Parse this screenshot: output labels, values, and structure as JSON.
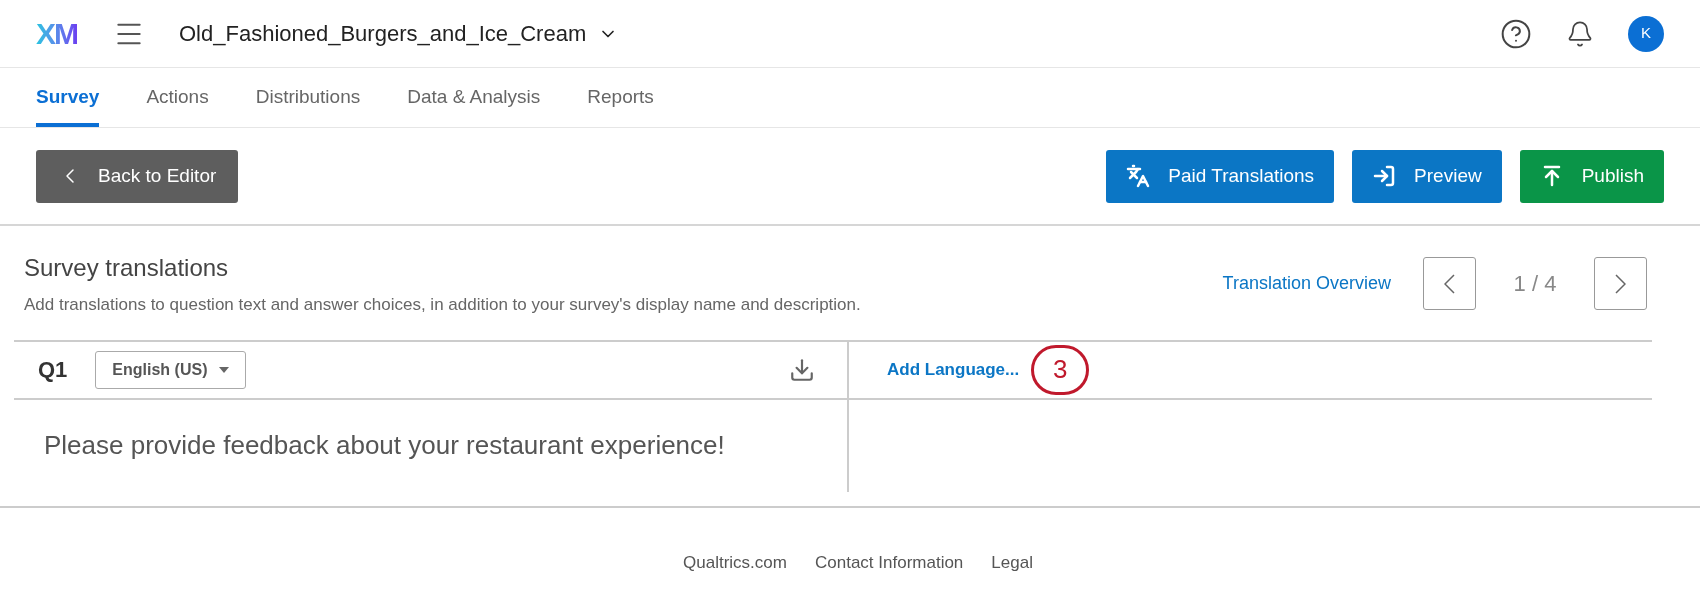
{
  "header": {
    "logo": "XM",
    "project_title": "Old_Fashioned_Burgers_and_Ice_Cream",
    "avatar_initial": "K"
  },
  "tabs": [
    {
      "label": "Survey",
      "selected": true
    },
    {
      "label": "Actions",
      "selected": false
    },
    {
      "label": "Distributions",
      "selected": false
    },
    {
      "label": "Data & Analysis",
      "selected": false
    },
    {
      "label": "Reports",
      "selected": false
    }
  ],
  "toolbar": {
    "back_button": "Back to Editor",
    "buttons": [
      {
        "label": "Paid Translations",
        "kind": "translate"
      },
      {
        "label": "Preview",
        "kind": "preview"
      },
      {
        "label": "Publish",
        "kind": "publish"
      }
    ]
  },
  "section": {
    "title": "Survey translations",
    "description": "Add translations to question text and answer choices, in addition to your survey's display name and description.",
    "overview_link": "Translation Overview",
    "pager": "1 / 4"
  },
  "question": {
    "number": "Q1",
    "language": "English (US)",
    "text": "Please provide feedback about your restaurant experience!",
    "add_language": "Add Language...",
    "annotation": "3"
  },
  "footer": {
    "links": [
      "Qualtrics.com",
      "Contact Information",
      "Legal"
    ]
  }
}
